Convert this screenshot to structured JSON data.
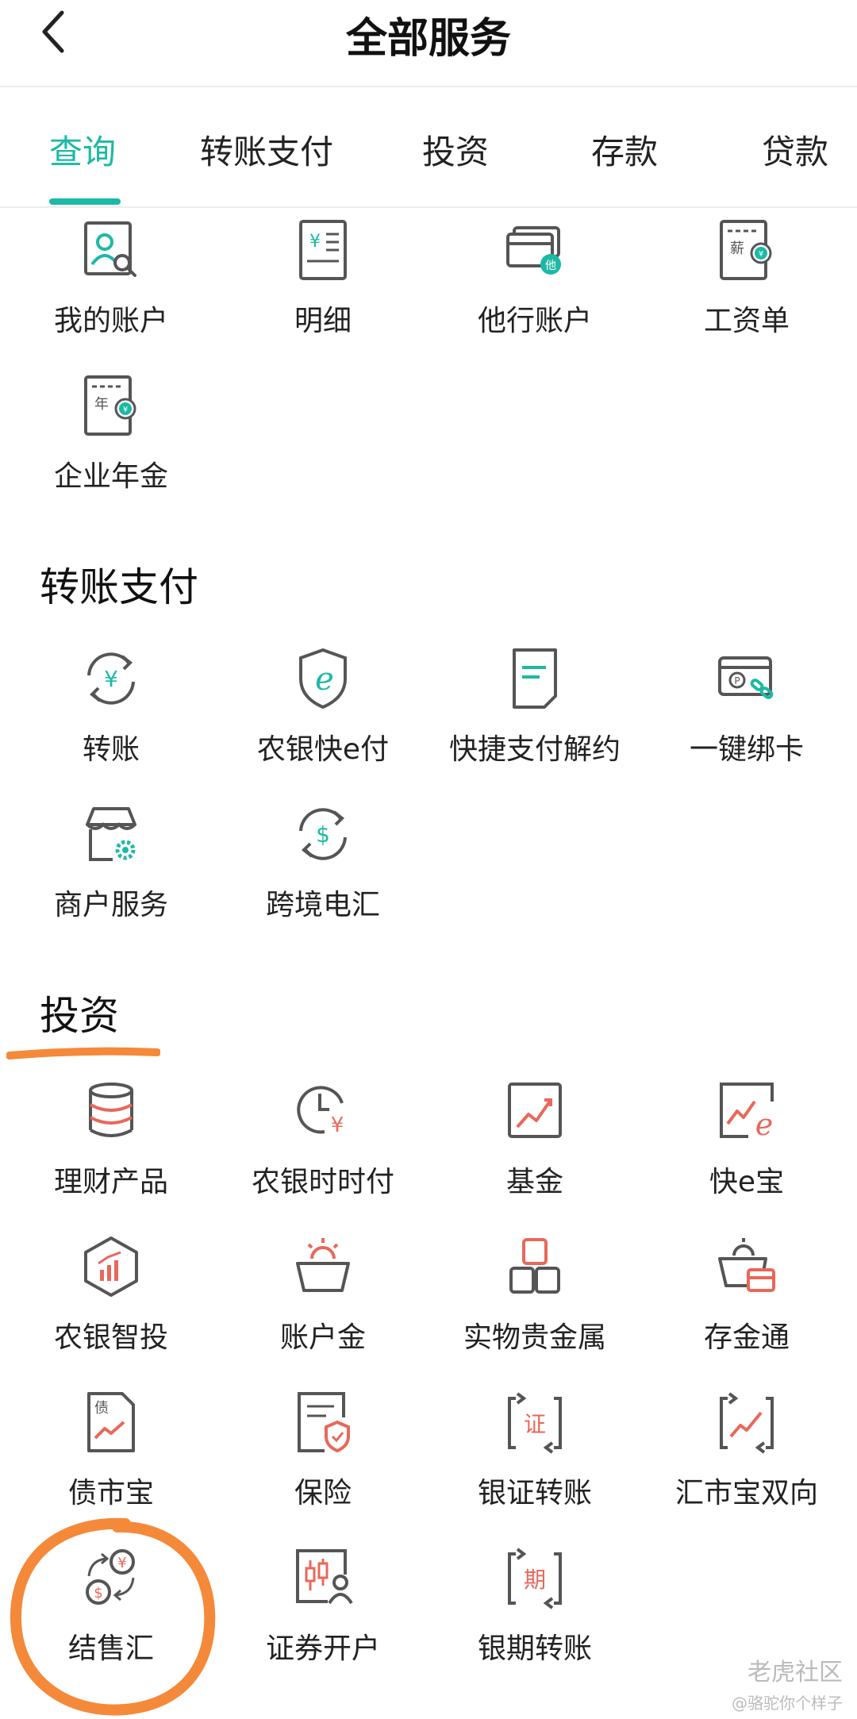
{
  "header": {
    "title": "全部服务"
  },
  "tabs": [
    {
      "label": "查询",
      "active": true
    },
    {
      "label": "转账支付",
      "active": false
    },
    {
      "label": "投资",
      "active": false
    },
    {
      "label": "存款",
      "active": false
    },
    {
      "label": "贷款",
      "active": false
    }
  ],
  "sections": {
    "query": {
      "items": [
        {
          "label": "我的账户",
          "icon": "account-search-icon"
        },
        {
          "label": "明细",
          "icon": "statement-detail-icon"
        },
        {
          "label": "他行账户",
          "icon": "other-bank-card-icon"
        },
        {
          "label": "工资单",
          "icon": "payslip-icon"
        },
        {
          "label": "企业年金",
          "icon": "annuity-icon"
        }
      ]
    },
    "transfer": {
      "title": "转账支付",
      "items": [
        {
          "label": "转账",
          "icon": "transfer-icon"
        },
        {
          "label": "农银快e付",
          "icon": "e-pay-shield-icon"
        },
        {
          "label": "快捷支付解约",
          "icon": "document-icon"
        },
        {
          "label": "一键绑卡",
          "icon": "card-link-icon"
        },
        {
          "label": "商户服务",
          "icon": "merchant-store-icon"
        },
        {
          "label": "跨境电汇",
          "icon": "cross-border-dollar-icon"
        }
      ]
    },
    "invest": {
      "title": "投资",
      "items": [
        {
          "label": "理财产品",
          "icon": "coin-stack-icon"
        },
        {
          "label": "农银时时付",
          "icon": "clock-yuan-icon"
        },
        {
          "label": "基金",
          "icon": "fund-chart-icon"
        },
        {
          "label": "快e宝",
          "icon": "quick-e-chart-icon"
        },
        {
          "label": "农银智投",
          "icon": "smart-invest-hexagon-icon"
        },
        {
          "label": "账户金",
          "icon": "gold-basket-icon"
        },
        {
          "label": "实物贵金属",
          "icon": "gold-bars-icon"
        },
        {
          "label": "存金通",
          "icon": "gold-deposit-icon"
        },
        {
          "label": "债市宝",
          "icon": "bond-document-icon"
        },
        {
          "label": "保险",
          "icon": "insurance-shield-icon"
        },
        {
          "label": "银证转账",
          "icon": "bank-securities-transfer-icon"
        },
        {
          "label": "汇市宝双向",
          "icon": "forex-two-way-icon"
        },
        {
          "label": "结售汇",
          "icon": "currency-exchange-icon"
        },
        {
          "label": "证券开户",
          "icon": "securities-account-icon"
        },
        {
          "label": "银期转账",
          "icon": "bank-futures-transfer-icon"
        }
      ]
    }
  },
  "watermark": {
    "line1": "老虎社区",
    "line2": "@骆驼你个样子"
  },
  "colors": {
    "accent": "#1cb9a5",
    "icon_red": "#e8685a",
    "icon_gray": "#555555",
    "highlight_orange": "#f5893a"
  }
}
